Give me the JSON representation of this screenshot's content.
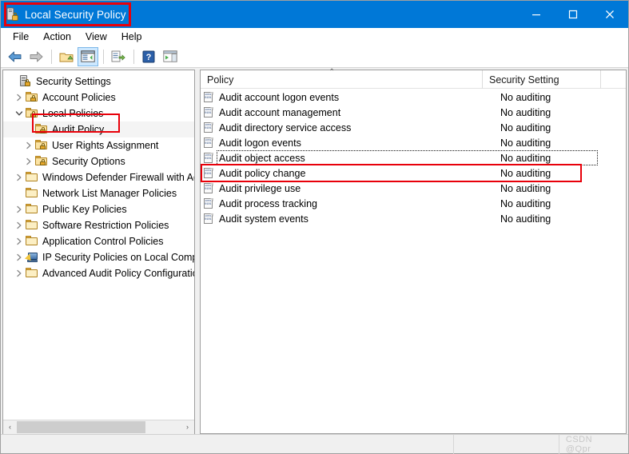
{
  "window": {
    "title": "Local Security Policy",
    "app_icon": "security-policy-icon",
    "titlebar_color": "#0078d7",
    "annotation_color": "#e8000a"
  },
  "titlebar_buttons": [
    {
      "name": "minimize",
      "label": "—"
    },
    {
      "name": "maximize",
      "label": "☐"
    },
    {
      "name": "close",
      "label": "✕"
    }
  ],
  "menu": {
    "items": [
      {
        "label": "File"
      },
      {
        "label": "Action"
      },
      {
        "label": "View"
      },
      {
        "label": "Help"
      }
    ]
  },
  "toolbar": {
    "buttons": [
      {
        "name": "back-arrow-icon",
        "active": false
      },
      {
        "name": "forward-arrow-icon",
        "active": false
      },
      {
        "name": "up-folder-icon",
        "active": false
      },
      {
        "name": "show-hide-console-tree-icon",
        "active": true
      },
      {
        "name": "export-list-icon",
        "active": false
      },
      {
        "name": "help-icon",
        "active": false
      },
      {
        "name": "show-action-pane-icon",
        "active": false
      }
    ]
  },
  "tree": {
    "items": [
      {
        "label": "Security Settings",
        "indent": 0,
        "twisty": "none",
        "icon": "server-lock-icon"
      },
      {
        "label": "Account Policies",
        "indent": 1,
        "twisty": "collapsed",
        "icon": "folder-lock-icon"
      },
      {
        "label": "Local Policies",
        "indent": 1,
        "twisty": "expanded",
        "icon": "folder-lock-icon"
      },
      {
        "label": "Audit Policy",
        "indent": 2,
        "twisty": "none",
        "icon": "folder-lock-icon",
        "selected": true
      },
      {
        "label": "User Rights Assignment",
        "indent": 2,
        "twisty": "collapsed",
        "icon": "folder-lock-icon"
      },
      {
        "label": "Security Options",
        "indent": 2,
        "twisty": "collapsed",
        "icon": "folder-lock-icon"
      },
      {
        "label": "Windows Defender Firewall with Adva",
        "indent": 1,
        "twisty": "collapsed",
        "icon": "folder-icon"
      },
      {
        "label": "Network List Manager Policies",
        "indent": 1,
        "twisty": "none",
        "icon": "folder-icon"
      },
      {
        "label": "Public Key Policies",
        "indent": 1,
        "twisty": "collapsed",
        "icon": "folder-icon"
      },
      {
        "label": "Software Restriction Policies",
        "indent": 1,
        "twisty": "collapsed",
        "icon": "folder-icon"
      },
      {
        "label": "Application Control Policies",
        "indent": 1,
        "twisty": "collapsed",
        "icon": "folder-icon"
      },
      {
        "label": "IP Security Policies on Local Compute",
        "indent": 1,
        "twisty": "collapsed",
        "icon": "ipsec-icon"
      },
      {
        "label": "Advanced Audit Policy Configuration",
        "indent": 1,
        "twisty": "collapsed",
        "icon": "folder-icon"
      }
    ],
    "scrollbar": {
      "left_arrow": "‹",
      "right_arrow": "›"
    }
  },
  "list": {
    "columns": [
      {
        "label": "Policy",
        "sorted": "ascending",
        "sort_glyph": "⌃"
      },
      {
        "label": "Security Setting"
      }
    ],
    "rows": [
      {
        "policy": "Audit account logon events",
        "setting": "No auditing"
      },
      {
        "policy": "Audit account management",
        "setting": "No auditing"
      },
      {
        "policy": "Audit directory service access",
        "setting": "No auditing"
      },
      {
        "policy": "Audit logon events",
        "setting": "No auditing"
      },
      {
        "policy": "Audit object access",
        "setting": "No auditing",
        "focused": true
      },
      {
        "policy": "Audit policy change",
        "setting": "No auditing"
      },
      {
        "policy": "Audit privilege use",
        "setting": "No auditing"
      },
      {
        "policy": "Audit process tracking",
        "setting": "No auditing"
      },
      {
        "policy": "Audit system events",
        "setting": "No auditing"
      }
    ]
  },
  "statusbar": {
    "left": "",
    "middle": "",
    "watermark": "CSDN @Qpr"
  }
}
